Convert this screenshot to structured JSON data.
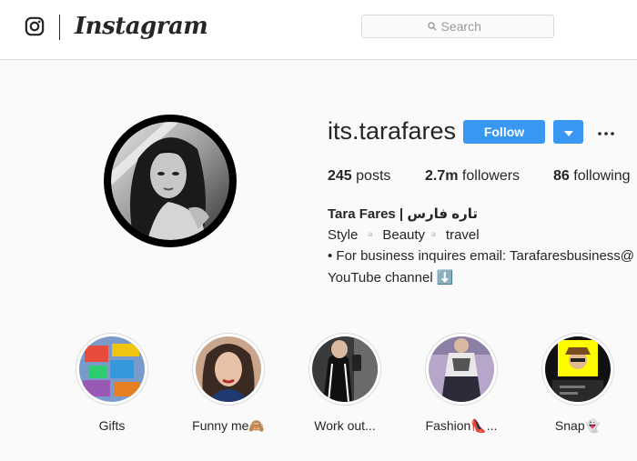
{
  "header": {
    "wordmark": "Instagram",
    "search_placeholder": "Search"
  },
  "profile": {
    "username": "its.tarafares",
    "follow_label": "Follow",
    "stats": [
      {
        "value": "245",
        "label": "posts"
      },
      {
        "value": "2.7m",
        "label": "followers"
      },
      {
        "value": "86",
        "label": "following"
      }
    ],
    "bio": {
      "name": "Tara Fares | تاره فارس",
      "lines": [
        "Style ▫️ Beauty▫️ travel",
        "• For business inquires email: Tarafaresbusiness@",
        "YouTube channel ⬇️"
      ]
    }
  },
  "highlights": [
    {
      "label": "Gifts"
    },
    {
      "label": "Funny me🙈"
    },
    {
      "label": "Work out..."
    },
    {
      "label": "Fashion👠..."
    },
    {
      "label": "Snap👻"
    }
  ],
  "colors": {
    "accent": "#3897f0",
    "border": "#dbdbdb",
    "background": "#fafafa"
  }
}
